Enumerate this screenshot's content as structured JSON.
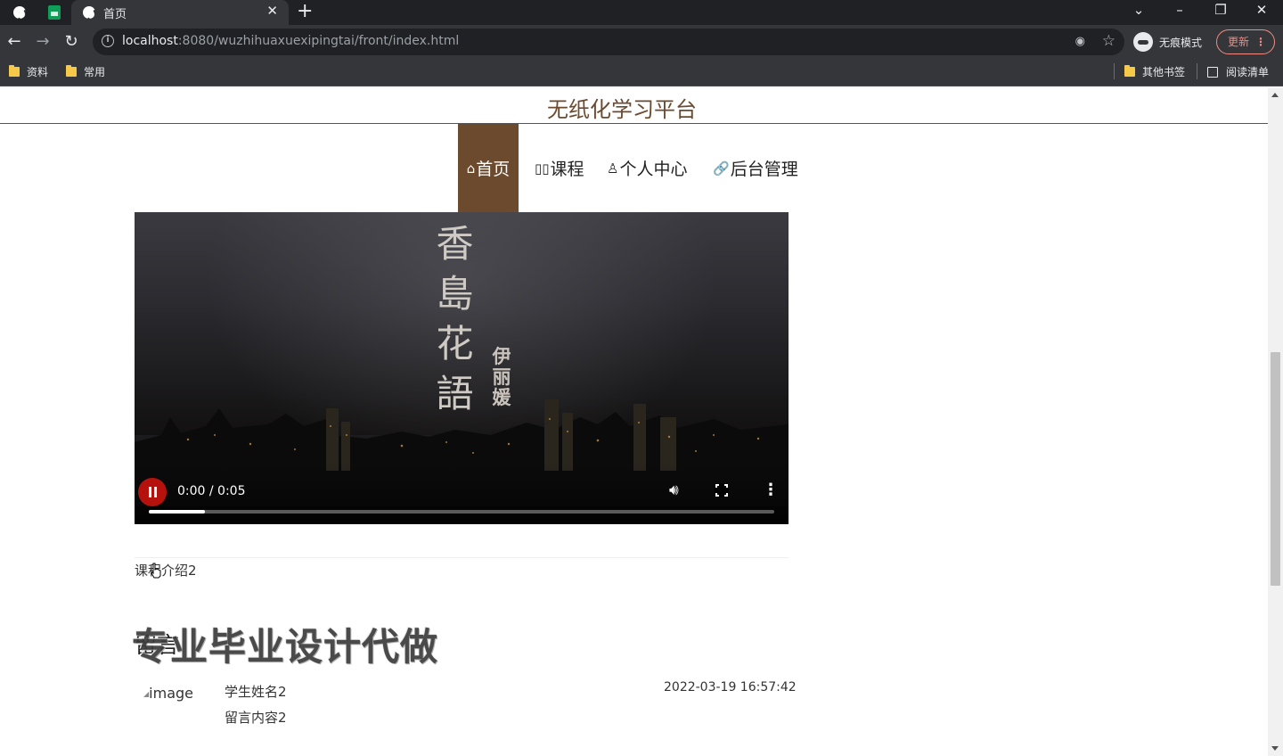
{
  "browser": {
    "tab_title": "首页",
    "url_host": "localhost",
    "url_rest": ":8080/wuzhihuaxuexipingtai/front/index.html",
    "incognito_label": "无痕模式",
    "update_label": "更新",
    "bookmarks": [
      "资料",
      "常用"
    ],
    "other_bookmarks": "其他书签",
    "reading_list": "阅读清单"
  },
  "site": {
    "title": "无纸化学习平台",
    "nav": [
      {
        "icon": "⌂",
        "label": "首页",
        "active": true
      },
      {
        "icon": "▯▯",
        "label": "课程",
        "active": false
      },
      {
        "icon": "♙",
        "label": "个人中心",
        "active": false
      },
      {
        "icon": "🔗",
        "label": "后台管理",
        "active": false
      }
    ]
  },
  "video": {
    "poem": "香島花語",
    "artist": "伊丽媛",
    "time": "0:00 / 0:05",
    "progress": 0.09
  },
  "course_intro": "课程介绍2",
  "messages_heading": "留言",
  "watermark": "专业毕业设计代做",
  "comment": {
    "image_alt": "image",
    "student_name": "学生姓名2",
    "content": "留言内容2",
    "time": "2022-03-19 16:57:42"
  }
}
